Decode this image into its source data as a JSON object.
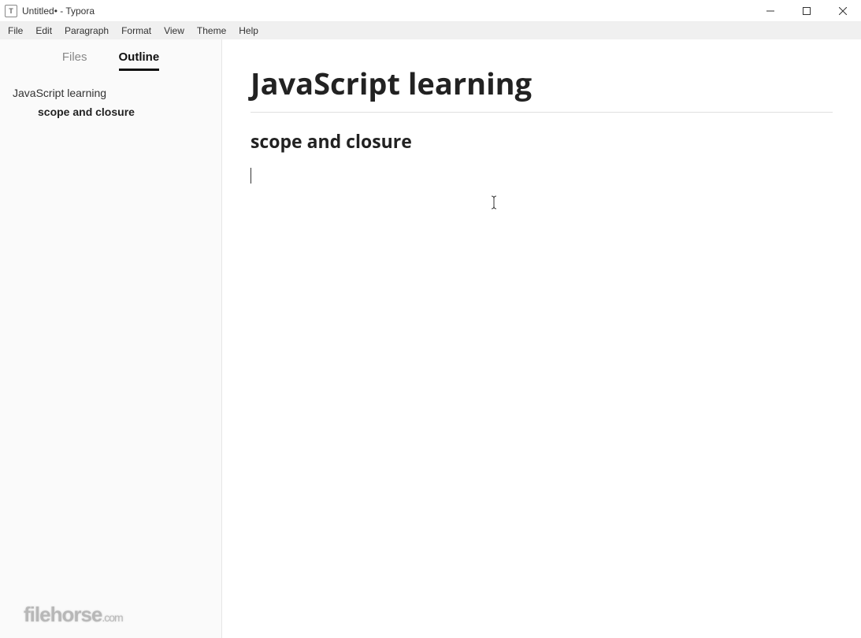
{
  "titlebar": {
    "icon_label": "T",
    "title": "Untitled• - Typora"
  },
  "menubar": {
    "items": [
      "File",
      "Edit",
      "Paragraph",
      "Format",
      "View",
      "Theme",
      "Help"
    ]
  },
  "sidebar": {
    "tabs": {
      "files": "Files",
      "outline": "Outline"
    },
    "active_tab": "outline",
    "outline": [
      {
        "label": "JavaScript learning",
        "level": 1
      },
      {
        "label": "scope and closure",
        "level": 2
      }
    ]
  },
  "editor": {
    "h1": "JavaScript learning",
    "h2": "scope and closure"
  },
  "watermark": {
    "main": "filehorse",
    "suffix": ".com"
  }
}
